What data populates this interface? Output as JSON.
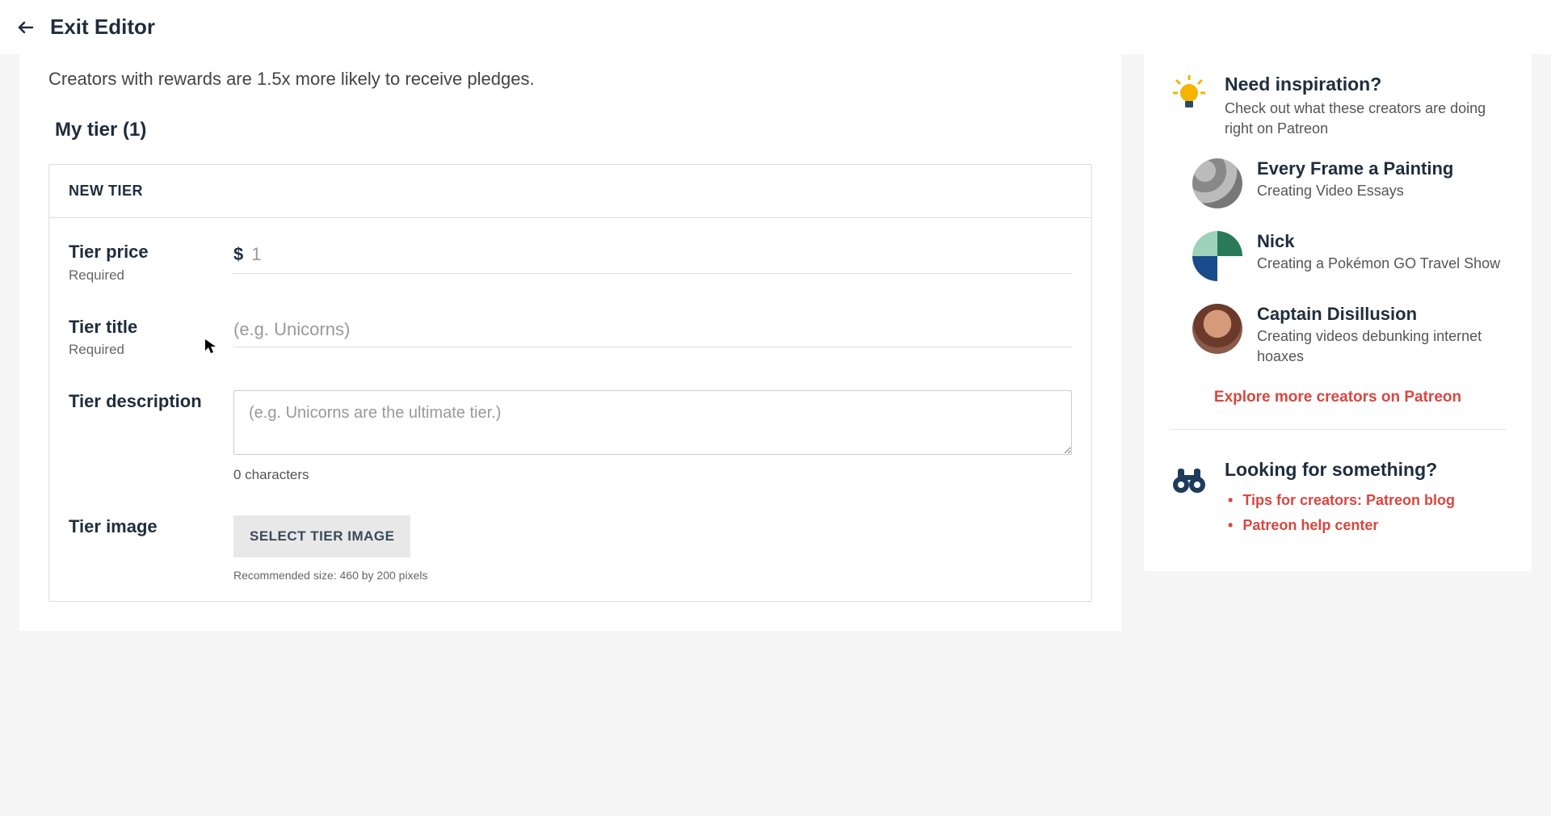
{
  "header": {
    "exit_label": "Exit Editor"
  },
  "main": {
    "subtitle": "Creators with rewards are 1.5x more likely to receive pledges.",
    "tiers_heading": "My tier (1)",
    "card_header": "NEW TIER",
    "fields": {
      "price": {
        "label": "Tier price",
        "sub": "Required",
        "currency": "$",
        "placeholder": "1"
      },
      "title": {
        "label": "Tier title",
        "sub": "Required",
        "placeholder": "(e.g. Unicorns)"
      },
      "description": {
        "label": "Tier description",
        "placeholder": "(e.g. Unicorns are the ultimate tier.)",
        "char_count": "0 characters"
      },
      "image": {
        "label": "Tier image",
        "button": "SELECT TIER IMAGE",
        "hint": "Recommended size: 460 by 200 pixels"
      }
    }
  },
  "sidebar": {
    "inspiration": {
      "title": "Need inspiration?",
      "sub": "Check out what these creators are doing right on Patreon",
      "creators": [
        {
          "name": "Every Frame a Painting",
          "desc": "Creating Video Essays"
        },
        {
          "name": "Nick",
          "desc": "Creating a Pokémon GO Travel Show"
        },
        {
          "name": "Captain Disillusion",
          "desc": "Creating videos debunking internet hoaxes"
        }
      ],
      "explore": "Explore more creators on Patreon"
    },
    "looking": {
      "title": "Looking for something?",
      "links": [
        "Tips for creators: Patreon blog",
        "Patreon help center"
      ]
    }
  }
}
